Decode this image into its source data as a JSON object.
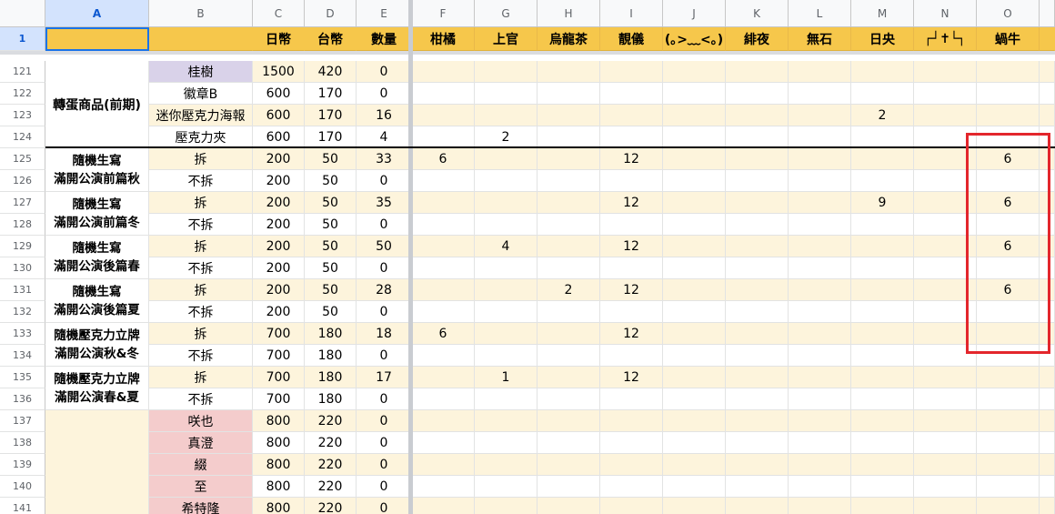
{
  "column_headers": [
    "A",
    "B",
    "C",
    "D",
    "E",
    "F",
    "G",
    "H",
    "I",
    "J",
    "K",
    "L",
    "M",
    "N",
    "O"
  ],
  "row1": {
    "num": "1",
    "labels": [
      "",
      "",
      "日幣",
      "台幣",
      "數量",
      "柑橘",
      "上官",
      "烏龍茶",
      "靚儀",
      "(｡>﹏<｡)",
      "緋夜",
      "無石",
      "日央",
      "┌┘✝└┐",
      "蝸牛"
    ]
  },
  "rows": [
    {
      "num": "121",
      "b": "桂樹",
      "c": "1500",
      "d": "420",
      "e": "0",
      "f": "",
      "g": "",
      "h": "",
      "i": "",
      "m": "",
      "o": ""
    },
    {
      "num": "122",
      "b": "徽章B",
      "c": "600",
      "d": "170",
      "e": "0",
      "f": "",
      "g": "",
      "h": "",
      "i": "",
      "m": "",
      "o": ""
    },
    {
      "num": "123",
      "b": "迷你壓克力海報",
      "c": "600",
      "d": "170",
      "e": "16",
      "f": "",
      "g": "",
      "h": "",
      "i": "",
      "m": "2",
      "o": ""
    },
    {
      "num": "124",
      "b": "壓克力夾",
      "c": "600",
      "d": "170",
      "e": "4",
      "f": "",
      "g": "2",
      "h": "",
      "i": "",
      "m": "",
      "o": ""
    },
    {
      "num": "125",
      "b": "拆",
      "c": "200",
      "d": "50",
      "e": "33",
      "f": "6",
      "g": "",
      "h": "",
      "i": "12",
      "m": "",
      "o": "6"
    },
    {
      "num": "126",
      "b": "不拆",
      "c": "200",
      "d": "50",
      "e": "0",
      "f": "",
      "g": "",
      "h": "",
      "i": "",
      "m": "",
      "o": ""
    },
    {
      "num": "127",
      "b": "拆",
      "c": "200",
      "d": "50",
      "e": "35",
      "f": "",
      "g": "",
      "h": "",
      "i": "12",
      "m": "9",
      "o": "6"
    },
    {
      "num": "128",
      "b": "不拆",
      "c": "200",
      "d": "50",
      "e": "0",
      "f": "",
      "g": "",
      "h": "",
      "i": "",
      "m": "",
      "o": ""
    },
    {
      "num": "129",
      "b": "拆",
      "c": "200",
      "d": "50",
      "e": "50",
      "f": "",
      "g": "4",
      "h": "",
      "i": "12",
      "m": "",
      "o": "6"
    },
    {
      "num": "130",
      "b": "不拆",
      "c": "200",
      "d": "50",
      "e": "0",
      "f": "",
      "g": "",
      "h": "",
      "i": "",
      "m": "",
      "o": ""
    },
    {
      "num": "131",
      "b": "拆",
      "c": "200",
      "d": "50",
      "e": "28",
      "f": "",
      "g": "",
      "h": "2",
      "i": "12",
      "m": "",
      "o": "6"
    },
    {
      "num": "132",
      "b": "不拆",
      "c": "200",
      "d": "50",
      "e": "0",
      "f": "",
      "g": "",
      "h": "",
      "i": "",
      "m": "",
      "o": ""
    },
    {
      "num": "133",
      "b": "拆",
      "c": "700",
      "d": "180",
      "e": "18",
      "f": "6",
      "g": "",
      "h": "",
      "i": "12",
      "m": "",
      "o": ""
    },
    {
      "num": "134",
      "b": "不拆",
      "c": "700",
      "d": "180",
      "e": "0",
      "f": "",
      "g": "",
      "h": "",
      "i": "",
      "m": "",
      "o": ""
    },
    {
      "num": "135",
      "b": "拆",
      "c": "700",
      "d": "180",
      "e": "17",
      "f": "",
      "g": "1",
      "h": "",
      "i": "12",
      "m": "",
      "o": ""
    },
    {
      "num": "136",
      "b": "不拆",
      "c": "700",
      "d": "180",
      "e": "0",
      "f": "",
      "g": "",
      "h": "",
      "i": "",
      "m": "",
      "o": ""
    },
    {
      "num": "137",
      "b": "咲也",
      "c": "800",
      "d": "220",
      "e": "0",
      "f": "",
      "g": "",
      "h": "",
      "i": "",
      "m": "",
      "o": ""
    },
    {
      "num": "138",
      "b": "真澄",
      "c": "800",
      "d": "220",
      "e": "0",
      "f": "",
      "g": "",
      "h": "",
      "i": "",
      "m": "",
      "o": ""
    },
    {
      "num": "139",
      "b": "綴",
      "c": "800",
      "d": "220",
      "e": "0",
      "f": "",
      "g": "",
      "h": "",
      "i": "",
      "m": "",
      "o": ""
    },
    {
      "num": "140",
      "b": "至",
      "c": "800",
      "d": "220",
      "e": "0",
      "f": "",
      "g": "",
      "h": "",
      "i": "",
      "m": "",
      "o": ""
    },
    {
      "num": "141",
      "b": "希特隆",
      "c": "800",
      "d": "220",
      "e": "0",
      "f": "",
      "g": "",
      "h": "",
      "i": "",
      "m": "",
      "o": ""
    }
  ],
  "groups": [
    {
      "label": "轉蛋商品(前期)"
    },
    {
      "line1": "隨機生寫",
      "line2": "滿開公演前篇秋"
    },
    {
      "line1": "隨機生寫",
      "line2": "滿開公演前篇冬"
    },
    {
      "line1": "隨機生寫",
      "line2": "滿開公演後篇春"
    },
    {
      "line1": "隨機生寫",
      "line2": "滿開公演後篇夏"
    },
    {
      "line1": "隨機壓克力立牌",
      "line2": "滿開公演秋&冬"
    },
    {
      "line1": "隨機壓克力立牌",
      "line2": "滿開公演春&夏"
    }
  ],
  "colors": {
    "header_yellow": "#f6c74b",
    "band_cream": "#fdf4dc",
    "purple_cell": "#d9d2e9",
    "pink_cell": "#f4cccc",
    "selection_blue": "#1a73e8",
    "highlight_red": "#e3262c"
  }
}
